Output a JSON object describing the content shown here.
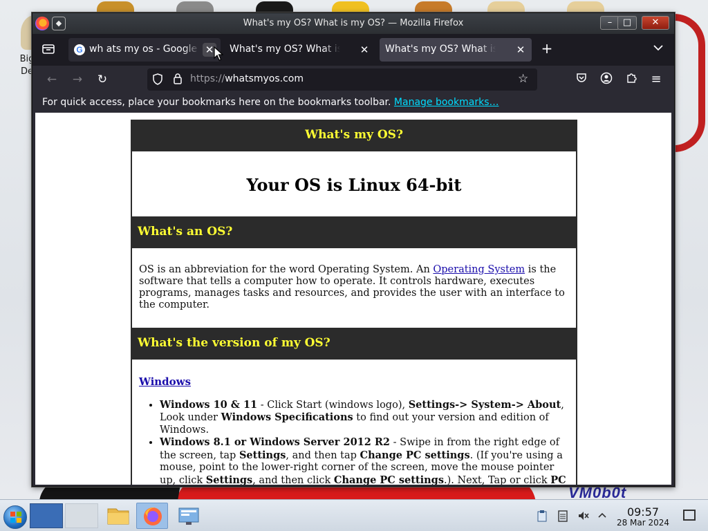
{
  "desktop": {
    "icon_label": "Big\nDe",
    "wallpaper_logo": "VM0b0t"
  },
  "window": {
    "title": "What's my OS? What is my OS? — Mozilla Firefox",
    "buttons": {
      "minimize": "–",
      "maximize": "□",
      "close": "✕"
    }
  },
  "tabs": [
    {
      "label": "wh ats my os - Google Search",
      "favicon": "G",
      "active": false
    },
    {
      "label": "What's my OS? What is my OS?",
      "active": false
    },
    {
      "label": "What's my OS? What is my OS?",
      "active": true
    }
  ],
  "navbar": {
    "url_scheme": "https://",
    "url_host": "whatsmyos.com"
  },
  "bookmarks_bar": {
    "text": "For quick access, place your bookmarks here on the bookmarks toolbar.",
    "link": "Manage bookmarks…"
  },
  "page": {
    "header": "What's my OS?",
    "result": "Your OS is Linux 64-bit",
    "whats_os_heading": "What's an OS?",
    "whats_os_text_1": "OS is an abbreviation for the word Operating System. An ",
    "whats_os_link": "Operating System",
    "whats_os_text_2": " is the software that tells a computer how to operate. It controls hardware, executes programs, manages tasks and resources, and provides the user with an interface to the computer.",
    "version_heading": "What's the version of my OS?",
    "windows_link": "Windows",
    "win10": {
      "b1": "Windows 10 & 11",
      "t1": " - Click Start (windows logo), ",
      "b2": "Settings-> System-> About",
      "t2": ", Look under ",
      "b3": "Windows Specifications",
      "t3": " to find out your version and edition of Windows."
    },
    "win81": {
      "b1": "Windows 8.1 or Windows Server 2012 R2",
      "t1": " - Swipe in from the right edge of the screen, tap ",
      "b2": "Settings",
      "t2": ", and then tap ",
      "b3": "Change PC settings",
      "t3": ". (If you're using a mouse, point to the lower-right corner of the screen, move the mouse pointer up, click ",
      "b4": "Settings",
      "t4": ", and then click ",
      "b5": "Change PC settings",
      "t5": ".). Next, Tap or click ",
      "b6": "PC and"
    }
  },
  "taskbar": {
    "time": "09:57",
    "date": "28 Mar 2024"
  },
  "colors": {
    "page_heading_bg": "#2b2b2b",
    "page_heading_text": "#ffff33",
    "link_cyan": "#00ddff",
    "tab_active_bg": "#42414d"
  }
}
